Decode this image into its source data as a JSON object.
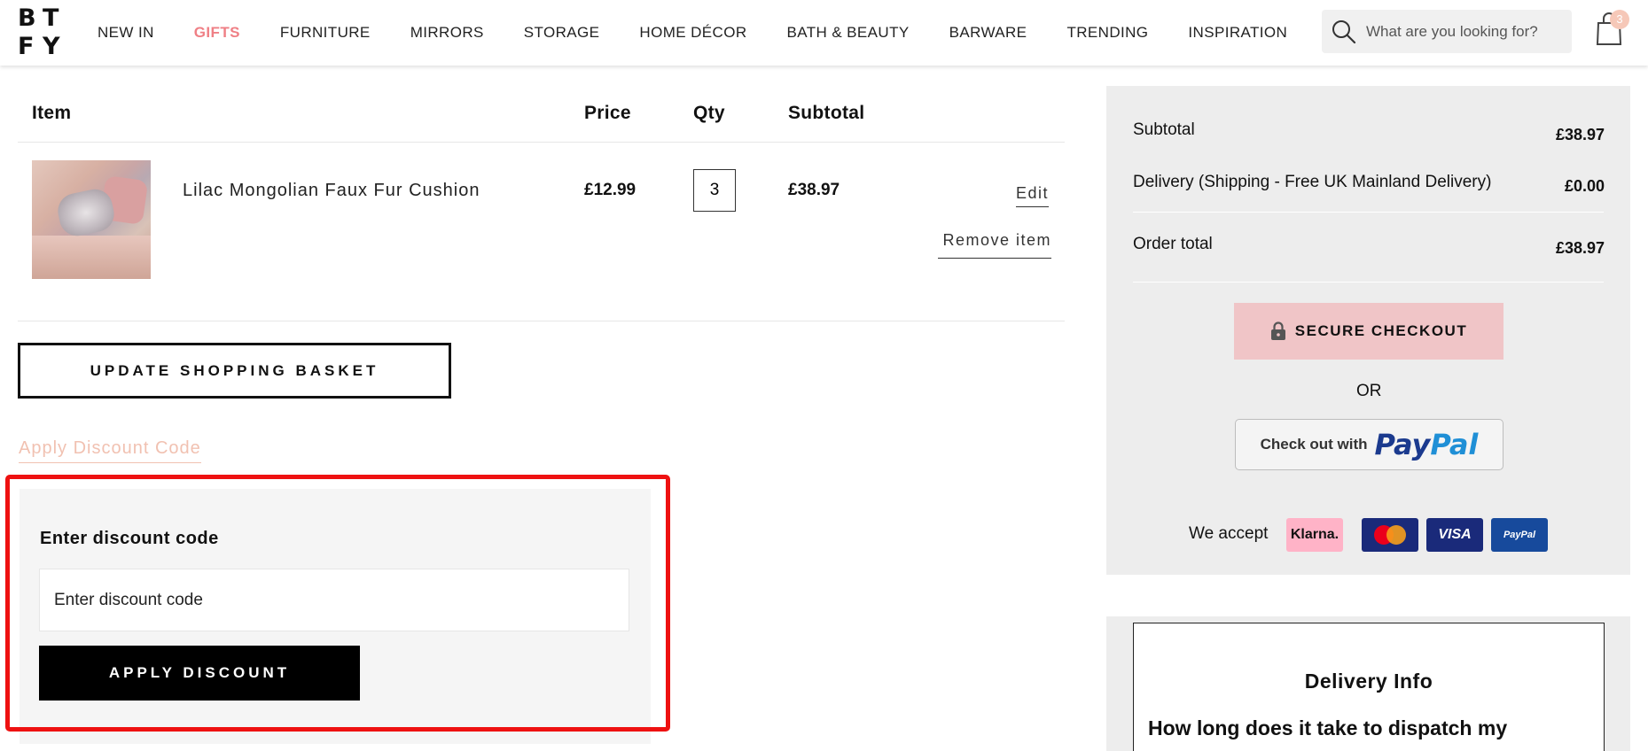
{
  "logo": {
    "letters": [
      "B",
      "T",
      "F",
      "Y"
    ]
  },
  "nav": {
    "items": [
      "NEW IN",
      "GIFTS",
      "FURNITURE",
      "MIRRORS",
      "STORAGE",
      "HOME DÉCOR",
      "BATH & BEAUTY",
      "BARWARE",
      "TRENDING",
      "INSPIRATION"
    ],
    "active": "GIFTS",
    "active_color": "#ef7f85"
  },
  "search": {
    "placeholder": "What are you looking for?",
    "icon": "search-icon"
  },
  "cart": {
    "count": "3",
    "icon": "shopping-bag-icon"
  },
  "table": {
    "headers": {
      "item": "Item",
      "price": "Price",
      "qty": "Qty",
      "subtotal": "Subtotal"
    },
    "rows": [
      {
        "name": "Lilac Mongolian Faux Fur Cushion",
        "price": "£12.99",
        "qty": "3",
        "subtotal": "£38.97",
        "edit": "Edit",
        "remove": "Remove item"
      }
    ]
  },
  "update_button": "UPDATE SHOPPING BASKET",
  "discount": {
    "link": "Apply Discount Code",
    "label": "Enter discount code",
    "placeholder": "Enter discount code",
    "button": "APPLY DISCOUNT"
  },
  "summary": {
    "subtotal_label": "Subtotal",
    "subtotal_value": "£38.97",
    "delivery_label": "Delivery (Shipping - Free UK Mainland Delivery)",
    "delivery_value": "£0.00",
    "total_label": "Order total",
    "total_value": "£38.97",
    "checkout_button": "SECURE CHECKOUT",
    "or": "OR",
    "paypal_prefix": "Check out with",
    "paypal_brand_a": "Pay",
    "paypal_brand_b": "Pal",
    "we_accept": "We accept",
    "payment_methods": [
      "Klarna.",
      "Mastercard",
      "VISA",
      "PayPal"
    ],
    "checkout_color": "#f0c5c7"
  },
  "delivery_info": {
    "title": "Delivery Info",
    "question": "How long does it take to dispatch my"
  }
}
